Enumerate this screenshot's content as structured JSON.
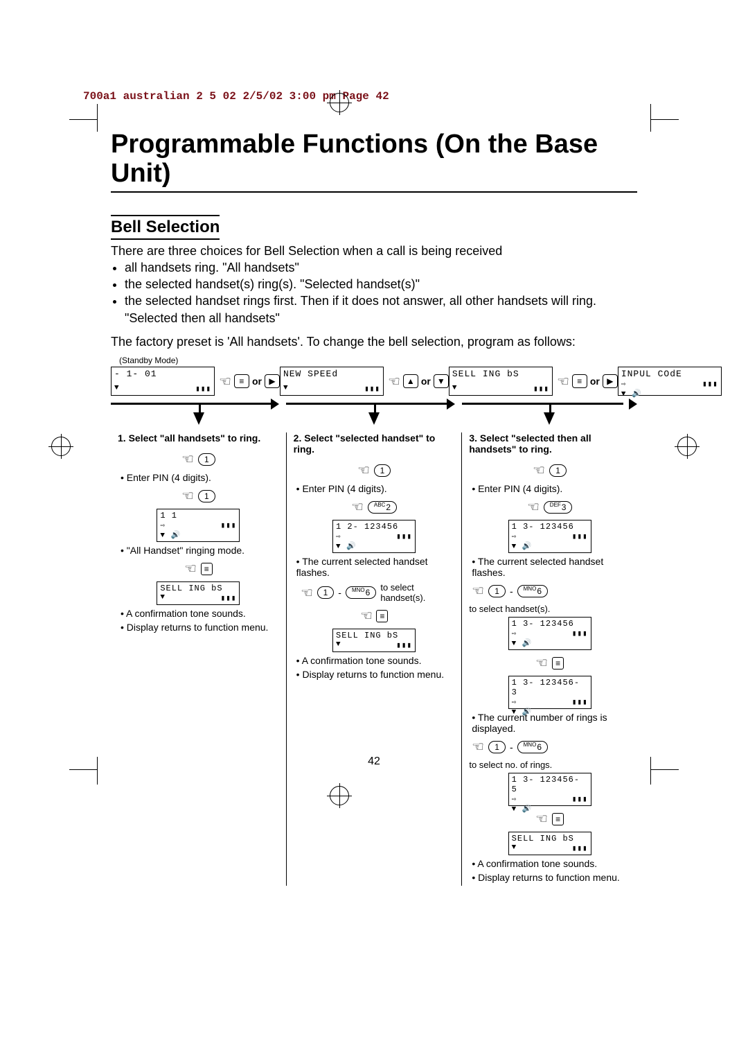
{
  "source_header": "700a1 australian 2 5 02  2/5/02  3:00 pm  Page 42",
  "title": "Programmable Functions (On the Base Unit)",
  "section": "Bell Selection",
  "intro": "There are three choices for Bell Selection when a call is being received",
  "bullets": [
    "all handsets ring. \"All handsets\"",
    "the selected handset(s) ring(s). \"Selected handset(s)\"",
    "the selected handset rings first. Then if it does not answer, all other handsets will ring. \"Selected then all handsets\""
  ],
  "preset": "The factory preset is 'All handsets'. To change the bell selection, program as follows:",
  "standby": "(Standby Mode)",
  "or": "or",
  "top_lcds": [
    {
      "line1": "- 1-      01"
    },
    {
      "line1": "NEW SPEEd"
    },
    {
      "line1": "SELL ING bS"
    },
    {
      "line1": "INPUL COdE"
    }
  ],
  "page_number": "42",
  "columns": [
    {
      "head": "1. Select \"all handsets\" to ring.",
      "key1": "1",
      "enter_pin": "Enter PIN (4 digits).",
      "pin_key": "1",
      "lcd_line": "1 1",
      "after_pin": "\"All Handset\" ringing mode.",
      "final_lcd": "SELL ING bS",
      "confirm1": "A confirmation tone sounds.",
      "confirm2": "Display returns to function menu."
    },
    {
      "head": "2. Select \"selected handset\" to ring.",
      "key1": "1",
      "enter_pin": "Enter PIN (4 digits).",
      "pin_key_sup": "ABC",
      "pin_key": "2",
      "lcd_line": "1 2- 123456",
      "after_pin": "The current selected handset flashes.",
      "range": "to select handset(s).",
      "range_from": "1",
      "range_to_sup": "MNO",
      "range_to": "6",
      "final_lcd": "SELL ING bS",
      "confirm1": "A confirmation tone sounds.",
      "confirm2": "Display returns to function menu."
    },
    {
      "head": "3. Select \"selected then all handsets\" to ring.",
      "key1": "1",
      "enter_pin": "Enter PIN (4 digits).",
      "pin_key_sup": "DEF",
      "pin_key": "3",
      "lcd_line": "1 3- 123456",
      "after_pin": "The current selected handset flashes.",
      "range_from": "1",
      "range_to_sup": "MNO",
      "range_to": "6",
      "range": "to select handset(s).",
      "lcd_line2": "1 3- 123456",
      "lcd_line3": "1 3- 123456- 3",
      "rings_note": "The current number of rings is displayed.",
      "range2_from": "1",
      "range2_to_sup": "MNO",
      "range2_to": "6",
      "range2": "to select no. of rings.",
      "lcd_line4": "1 3- 123456- 5",
      "final_lcd": "SELL ING bS",
      "confirm1": "A confirmation tone sounds.",
      "confirm2": "Display returns to function menu."
    }
  ]
}
